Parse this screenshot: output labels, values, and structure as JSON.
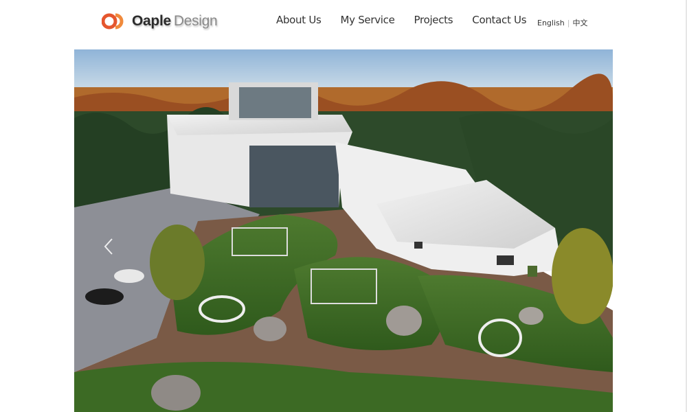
{
  "header": {
    "logo": {
      "word1": "Oaple",
      "word2": "Design",
      "accent_color": "#e5562e"
    },
    "nav": [
      {
        "label": "About Us"
      },
      {
        "label": "My Service"
      },
      {
        "label": "Projects"
      },
      {
        "label": "Contact Us"
      }
    ],
    "lang": {
      "english": "English",
      "separator": "|",
      "chinese": "中文"
    }
  },
  "hero": {
    "slider": {
      "prev_icon": "chevron-left-icon",
      "next_icon": "chevron-right-icon"
    },
    "image_subject": "aerial-architectural-rendering"
  }
}
